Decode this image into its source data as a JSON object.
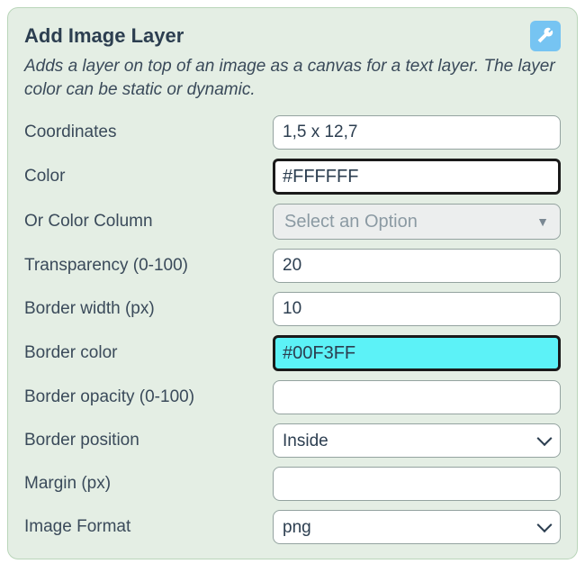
{
  "header": {
    "title": "Add Image Layer",
    "wrench_icon": "wrench-icon"
  },
  "description": "Adds a layer on top of an image as a canvas for a text layer. The layer color can be static or dynamic.",
  "fields": {
    "coordinates": {
      "label": "Coordinates",
      "value": "1,5 x 12,7"
    },
    "color": {
      "label": "Color",
      "value": "#FFFFFF"
    },
    "color_column": {
      "label": "Or Color Column",
      "placeholder": "Select an Option"
    },
    "transparency": {
      "label": "Transparency (0-100)",
      "value": "20"
    },
    "border_width": {
      "label": "Border width (px)",
      "value": "10"
    },
    "border_color": {
      "label": "Border color",
      "value": "#00F3FF"
    },
    "border_opacity": {
      "label": "Border opacity (0-100)",
      "value": ""
    },
    "border_position": {
      "label": "Border position",
      "value": "Inside",
      "options": [
        "Inside"
      ]
    },
    "margin": {
      "label": "Margin (px)",
      "value": ""
    },
    "image_format": {
      "label": "Image Format",
      "value": "png",
      "options": [
        "png"
      ]
    }
  }
}
